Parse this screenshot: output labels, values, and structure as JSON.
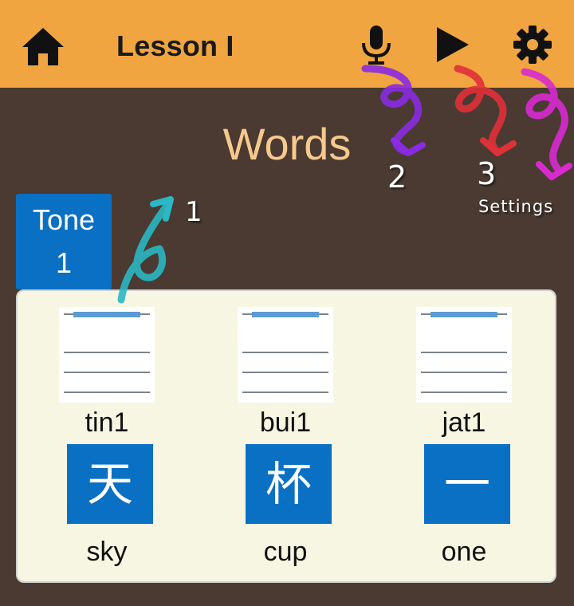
{
  "header": {
    "title": "Lesson I",
    "home_icon": "home-icon",
    "mic_icon": "microphone-icon",
    "play_icon": "play-icon",
    "settings_icon": "gear-icon"
  },
  "section_title": "Words",
  "tone_tab": {
    "label": "Tone",
    "number": "1"
  },
  "words": [
    {
      "jyutping": "tin1",
      "character": "天",
      "meaning": "sky"
    },
    {
      "jyutping": "bui1",
      "character": "杯",
      "meaning": "cup"
    },
    {
      "jyutping": "jat1",
      "character": "一",
      "meaning": "one"
    }
  ],
  "annotations": [
    {
      "label": "1",
      "color": "#2ab8c4"
    },
    {
      "label": "2",
      "color": "#8a2be2"
    },
    {
      "label": "3",
      "color": "#e0303a"
    },
    {
      "label": "Settings",
      "color": "#d82ad0"
    }
  ],
  "colors": {
    "header_bg": "#f0a540",
    "page_bg": "#4a3a31",
    "accent_blue": "#0a70c4",
    "panel_bg": "#f6f6e2",
    "title_color": "#f6c98d",
    "tone_line": "#5b9bd5"
  }
}
